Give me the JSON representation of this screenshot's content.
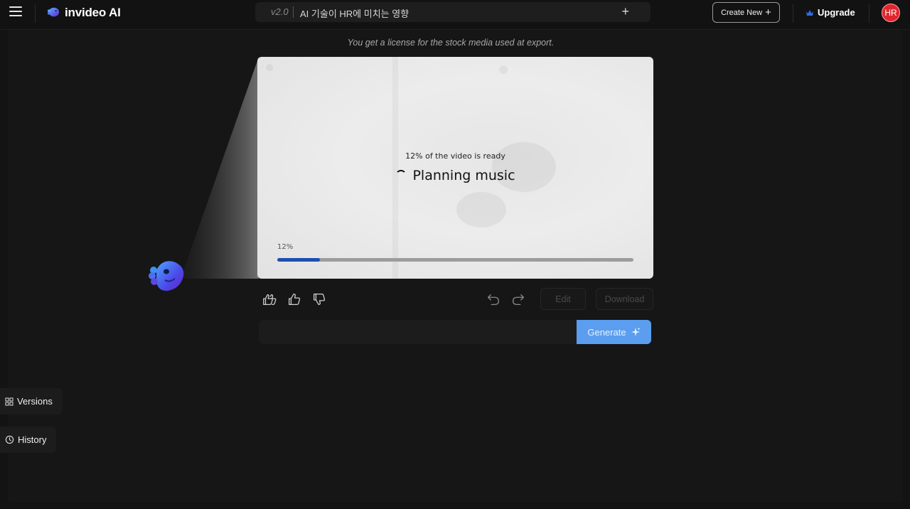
{
  "header": {
    "brand": "invideo AI",
    "project": {
      "version": "v2.0",
      "title": "AI 기술이 HR에 미치는 영향"
    },
    "create_new_label": "Create New",
    "upgrade_label": "Upgrade",
    "avatar_initials": "HR"
  },
  "license_note": "You get a license for the stock media used at export.",
  "video": {
    "ready_text": "12% of the video is ready",
    "status_text": "Planning music",
    "progress_label": "12%",
    "progress_fraction": 0.12
  },
  "actions": {
    "edit_label": "Edit",
    "download_label": "Download",
    "generate_label": "Generate"
  },
  "prompt": {
    "value": "",
    "placeholder": ""
  },
  "side_tabs": {
    "versions_label": "Versions",
    "history_label": "History"
  },
  "icons": {
    "menu": "hamburger-icon",
    "logo": "invideo-logo-icon",
    "plus": "plus-icon",
    "crown": "crown-icon",
    "thumbs_double": "double-thumbs-up-icon",
    "thumbs_up": "thumbs-up-icon",
    "thumbs_down": "thumbs-down-icon",
    "undo": "undo-icon",
    "redo": "redo-icon",
    "sparkle": "sparkle-icon",
    "grid": "grid-icon",
    "clock": "clock-icon",
    "mascot": "fish-mascot"
  },
  "colors": {
    "accent": "#5b9ef0",
    "progress": "#1d4fae",
    "avatar": "#e0262d",
    "crown": "#2f6fe6",
    "background": "#131313"
  }
}
